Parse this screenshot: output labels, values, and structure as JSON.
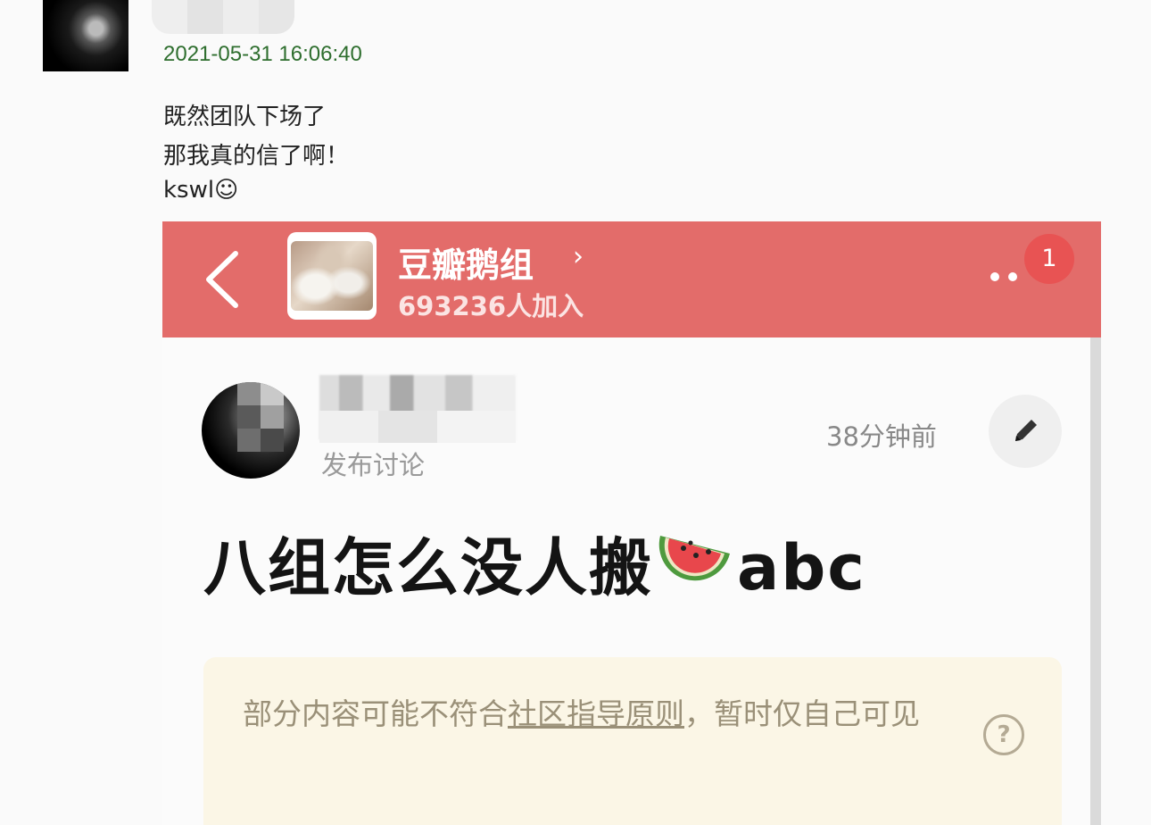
{
  "comment": {
    "timestamp": "2021-05-31 16:06:40",
    "lines": [
      "既然团队下场了",
      "那我真的信了啊！",
      "kswl☺"
    ]
  },
  "embedded": {
    "header": {
      "group_name": "豆瓣鹅组",
      "members": "693236人加入",
      "badge_count": "1",
      "chevron": "›",
      "header_color": "#e36c6a"
    },
    "post": {
      "action": "发布讨论",
      "time": "38分钟前",
      "title_before": "八组怎么没人搬",
      "title_after": "abc",
      "emoji_icon": "watermelon-icon"
    },
    "notice": {
      "text_before": "部分内容可能不符合",
      "link_text": "社区指导原则",
      "text_after": "，暂时仅自己可见",
      "help_symbol": "?"
    }
  }
}
